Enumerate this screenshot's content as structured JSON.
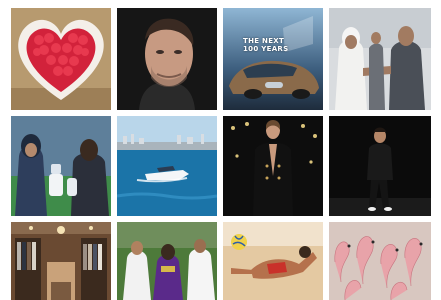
{
  "gallery": {
    "tiles": [
      {
        "id": "heart-raspberries"
      },
      {
        "id": "man-portrait"
      },
      {
        "id": "concept-car",
        "overlay_text": "THE NEXT\n100 YEARS"
      },
      {
        "id": "handshake-ceremony"
      },
      {
        "id": "robot-kids"
      },
      {
        "id": "speedboat-sea"
      },
      {
        "id": "runway-black-blazer"
      },
      {
        "id": "runway-man-black"
      },
      {
        "id": "clothing-store"
      },
      {
        "id": "football-match"
      },
      {
        "id": "volleyball-dive"
      },
      {
        "id": "flamingos"
      }
    ]
  }
}
